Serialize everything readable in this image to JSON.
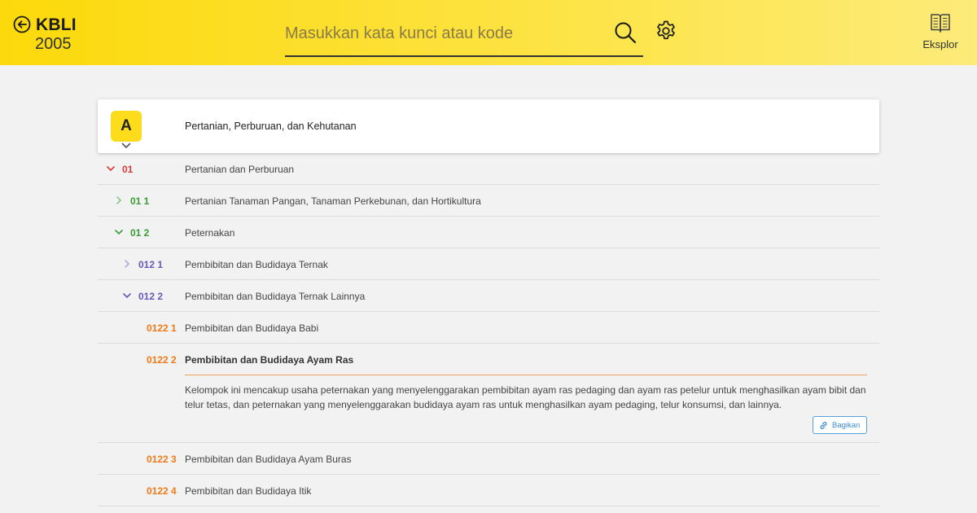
{
  "header": {
    "title": "KBLI",
    "year": "2005",
    "search_placeholder": "Masukkan kata kunci atau kode",
    "explore_label": "Eksplor"
  },
  "section": {
    "letter": "A",
    "title": "Pertanian, Perburuan, dan Kehutanan"
  },
  "rows": [
    {
      "code": "01",
      "label": "Pertanian dan Perburuan",
      "state": "expanded",
      "color": "#d83a3a"
    },
    {
      "code": "01 1",
      "label": "Pertanian Tanaman Pangan, Tanaman Perkebunan, dan Hortikultura",
      "state": "collapsed",
      "color": "#3a9a3a"
    },
    {
      "code": "01 2",
      "label": "Peternakan",
      "state": "expanded",
      "color": "#3a9a3a"
    },
    {
      "code": "012 1",
      "label": "Pembibitan dan Budidaya Ternak",
      "state": "collapsed",
      "color": "#6658b8"
    },
    {
      "code": "012 2",
      "label": "Pembibitan dan Budidaya Ternak Lainnya",
      "state": "expanded",
      "color": "#6658b8"
    },
    {
      "code": "0122 1",
      "label": "Pembibitan dan Budidaya Babi",
      "color": "#ee7a1a"
    },
    {
      "code": "0122 2",
      "label": "Pembibitan dan Budidaya Ayam Ras",
      "color": "#ee7a1a",
      "description": "Kelompok ini mencakup usaha peternakan yang menyelenggarakan pembibitan ayam ras pedaging dan ayam ras petelur untuk menghasilkan ayam bibit dan telur tetas, dan peternakan yang menyelenggarakan budidaya ayam ras untuk menghasilkan ayam pedaging, telur konsumsi, dan lainnya.",
      "share_label": "Bagikan"
    },
    {
      "code": "0122 3",
      "label": "Pembibitan dan Budidaya Ayam Buras",
      "color": "#ee7a1a"
    },
    {
      "code": "0122 4",
      "label": "Pembibitan dan Budidaya Itik",
      "color": "#ee7a1a"
    }
  ],
  "icons": {
    "back": "arrow-left-circle-icon",
    "search": "search-icon",
    "settings": "gear-icon",
    "explore": "open-book-icon",
    "share": "link-icon"
  },
  "colors": {
    "header_yellow": "#fcd90a",
    "section_badge": "#fcdc1b",
    "level_division": "#d83a3a",
    "level_group": "#3a9a3a",
    "level_class": "#6658b8",
    "level_subclass": "#ee7a1a",
    "share_blue": "#3b8ad0"
  }
}
